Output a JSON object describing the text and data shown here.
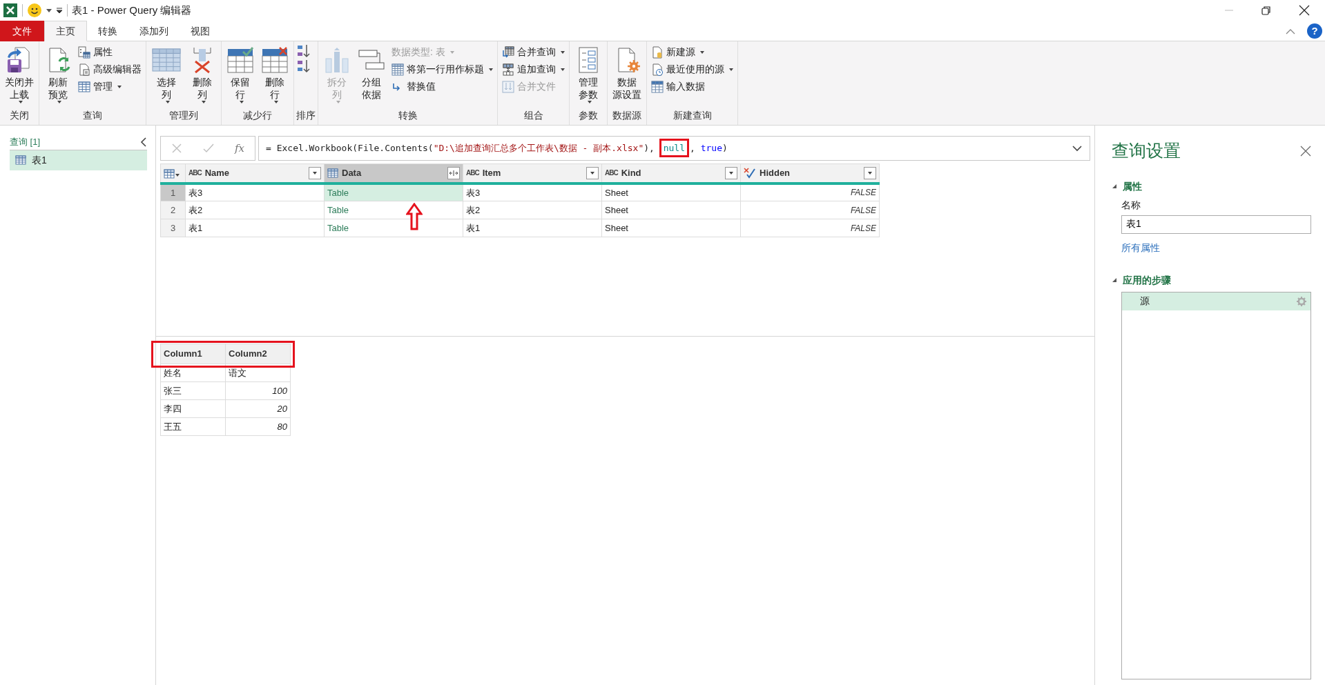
{
  "window": {
    "title": "表1 - Power Query 编辑器"
  },
  "ribbon_tabs": [
    {
      "label": "文件",
      "kind": "file",
      "selected": false
    },
    {
      "label": "主页",
      "kind": "tab",
      "selected": true
    },
    {
      "label": "转换",
      "kind": "tab",
      "selected": false
    },
    {
      "label": "添加列",
      "kind": "tab",
      "selected": false
    },
    {
      "label": "视图",
      "kind": "tab",
      "selected": false
    }
  ],
  "help": {
    "label": "?"
  },
  "ribbon_groups": [
    {
      "label": "关闭",
      "items": [
        {
          "kind": "large",
          "lines": [
            "关闭并",
            "上载"
          ],
          "dropdown": true,
          "disabled": false
        }
      ]
    },
    {
      "label": "查询",
      "items": [
        {
          "kind": "large",
          "lines": [
            "刷新",
            "预览"
          ],
          "dropdown": true,
          "disabled": false
        },
        {
          "kind": "small",
          "lines": [
            "属性"
          ],
          "dropdown": false,
          "disabled": false
        },
        {
          "kind": "small",
          "lines": [
            "高级编辑器"
          ],
          "dropdown": false,
          "disabled": false
        },
        {
          "kind": "small",
          "lines": [
            "管理"
          ],
          "dropdown": true,
          "disabled": false
        }
      ]
    },
    {
      "label": "管理列",
      "items": [
        {
          "kind": "large",
          "lines": [
            "选择",
            "列"
          ],
          "dropdown": true,
          "disabled": false
        },
        {
          "kind": "large",
          "lines": [
            "删除",
            "列"
          ],
          "dropdown": true,
          "disabled": false
        }
      ]
    },
    {
      "label": "减少行",
      "items": [
        {
          "kind": "large",
          "lines": [
            "保留",
            "行"
          ],
          "dropdown": true,
          "disabled": false
        },
        {
          "kind": "large",
          "lines": [
            "删除",
            "行"
          ],
          "dropdown": true,
          "disabled": false
        }
      ]
    },
    {
      "label": "排序",
      "items": [
        {
          "kind": "icon",
          "dropdown": false,
          "disabled": false
        },
        {
          "kind": "icon",
          "dropdown": false,
          "disabled": false
        }
      ]
    },
    {
      "label": "转换",
      "items": [
        {
          "kind": "large",
          "lines": [
            "拆分",
            "列"
          ],
          "dropdown": true,
          "disabled": true
        },
        {
          "kind": "large",
          "lines": [
            "分组",
            "依据"
          ],
          "dropdown": false,
          "disabled": false
        },
        {
          "kind": "small",
          "lines": [
            "数据类型: 表"
          ],
          "dropdown": true,
          "disabled": true
        },
        {
          "kind": "small",
          "lines": [
            "将第一行用作标题"
          ],
          "dropdown": true,
          "disabled": false
        },
        {
          "kind": "small",
          "lines": [
            "替换值"
          ],
          "dropdown": false,
          "disabled": false
        }
      ]
    },
    {
      "label": "组合",
      "items": [
        {
          "kind": "small",
          "lines": [
            "合并查询"
          ],
          "dropdown": true,
          "disabled": false
        },
        {
          "kind": "small",
          "lines": [
            "追加查询"
          ],
          "dropdown": true,
          "disabled": false
        },
        {
          "kind": "small",
          "lines": [
            "合并文件"
          ],
          "dropdown": false,
          "disabled": true
        }
      ]
    },
    {
      "label": "参数",
      "items": [
        {
          "kind": "large",
          "lines": [
            "管理",
            "参数"
          ],
          "dropdown": true,
          "disabled": false
        }
      ]
    },
    {
      "label": "数据源",
      "items": [
        {
          "kind": "large",
          "lines": [
            "数据",
            "源设置"
          ],
          "dropdown": false,
          "disabled": false
        }
      ]
    },
    {
      "label": "新建查询",
      "items": [
        {
          "kind": "small",
          "lines": [
            "新建源"
          ],
          "dropdown": true,
          "disabled": false
        },
        {
          "kind": "small",
          "lines": [
            "最近使用的源"
          ],
          "dropdown": true,
          "disabled": false
        },
        {
          "kind": "small",
          "lines": [
            "输入数据"
          ],
          "dropdown": false,
          "disabled": false
        }
      ]
    }
  ],
  "queries": {
    "header": "查询 [1]",
    "items": [
      {
        "label": "表1",
        "selected": true
      }
    ]
  },
  "formula_bar": {
    "function_label": "fx",
    "tokens": [
      {
        "text": "= Excel.Workbook(File.Contents(",
        "kind": "plain"
      },
      {
        "text": "\"D:\\追加查询汇总多个工作表\\数据 - 副本.xlsx\"",
        "kind": "string"
      },
      {
        "text": "), ",
        "kind": "plain"
      },
      {
        "text": "null",
        "kind": "literal",
        "highlighted": true
      },
      {
        "text": ", ",
        "kind": "plain"
      },
      {
        "text": "true",
        "kind": "keyword"
      },
      {
        "text": ")",
        "kind": "plain"
      }
    ]
  },
  "grid": {
    "columns": [
      {
        "name": "Name",
        "kind": "text",
        "type_glyph": "ABC",
        "selected": false
      },
      {
        "name": "Data",
        "kind": "table",
        "selected": true
      },
      {
        "name": "Item",
        "kind": "text",
        "type_glyph": "ABC",
        "selected": false
      },
      {
        "name": "Kind",
        "kind": "text",
        "type_glyph": "ABC",
        "selected": false
      },
      {
        "name": "Hidden",
        "kind": "logical",
        "selected": false
      }
    ],
    "rows": [
      {
        "number": "1",
        "cells": [
          {
            "text": "表3",
            "selected": false,
            "arrow": false
          },
          {
            "text": "Table",
            "selected": true,
            "arrow": true
          },
          {
            "text": "表3",
            "selected": false,
            "arrow": false
          },
          {
            "text": "Sheet",
            "selected": false,
            "arrow": false
          },
          {
            "text": "FALSE",
            "selected": false,
            "arrow": false
          }
        ]
      },
      {
        "number": "2",
        "cells": [
          {
            "text": "表2",
            "selected": false,
            "arrow": false
          },
          {
            "text": "Table",
            "selected": false,
            "arrow": false
          },
          {
            "text": "表2",
            "selected": false,
            "arrow": false
          },
          {
            "text": "Sheet",
            "selected": false,
            "arrow": false
          },
          {
            "text": "FALSE",
            "selected": false,
            "arrow": false
          }
        ]
      },
      {
        "number": "3",
        "cells": [
          {
            "text": "表1",
            "selected": false,
            "arrow": false
          },
          {
            "text": "Table",
            "selected": false,
            "arrow": false
          },
          {
            "text": "表1",
            "selected": false,
            "arrow": false
          },
          {
            "text": "Sheet",
            "selected": false,
            "arrow": false
          },
          {
            "text": "FALSE",
            "selected": false,
            "arrow": false
          }
        ]
      }
    ]
  },
  "preview": {
    "header_highlighted": true,
    "columns": [
      "Column1",
      "Column2"
    ],
    "rows": [
      [
        {
          "text": "姓名",
          "kind": "text"
        },
        {
          "text": "语文",
          "kind": "text"
        }
      ],
      [
        {
          "text": "张三",
          "kind": "text"
        },
        {
          "text": "100",
          "kind": "number"
        }
      ],
      [
        {
          "text": "李四",
          "kind": "text"
        },
        {
          "text": "20",
          "kind": "number"
        }
      ],
      [
        {
          "text": "王五",
          "kind": "text"
        },
        {
          "text": "80",
          "kind": "number"
        }
      ]
    ]
  },
  "settings": {
    "title": "查询设置",
    "properties": {
      "heading": "属性",
      "expanded": true,
      "name_label": "名称",
      "name_value": "表1",
      "link": "所有属性"
    },
    "steps_section": {
      "heading": "应用的步骤",
      "expanded": true,
      "steps": [
        {
          "label": "源",
          "selected": true
        }
      ]
    }
  }
}
